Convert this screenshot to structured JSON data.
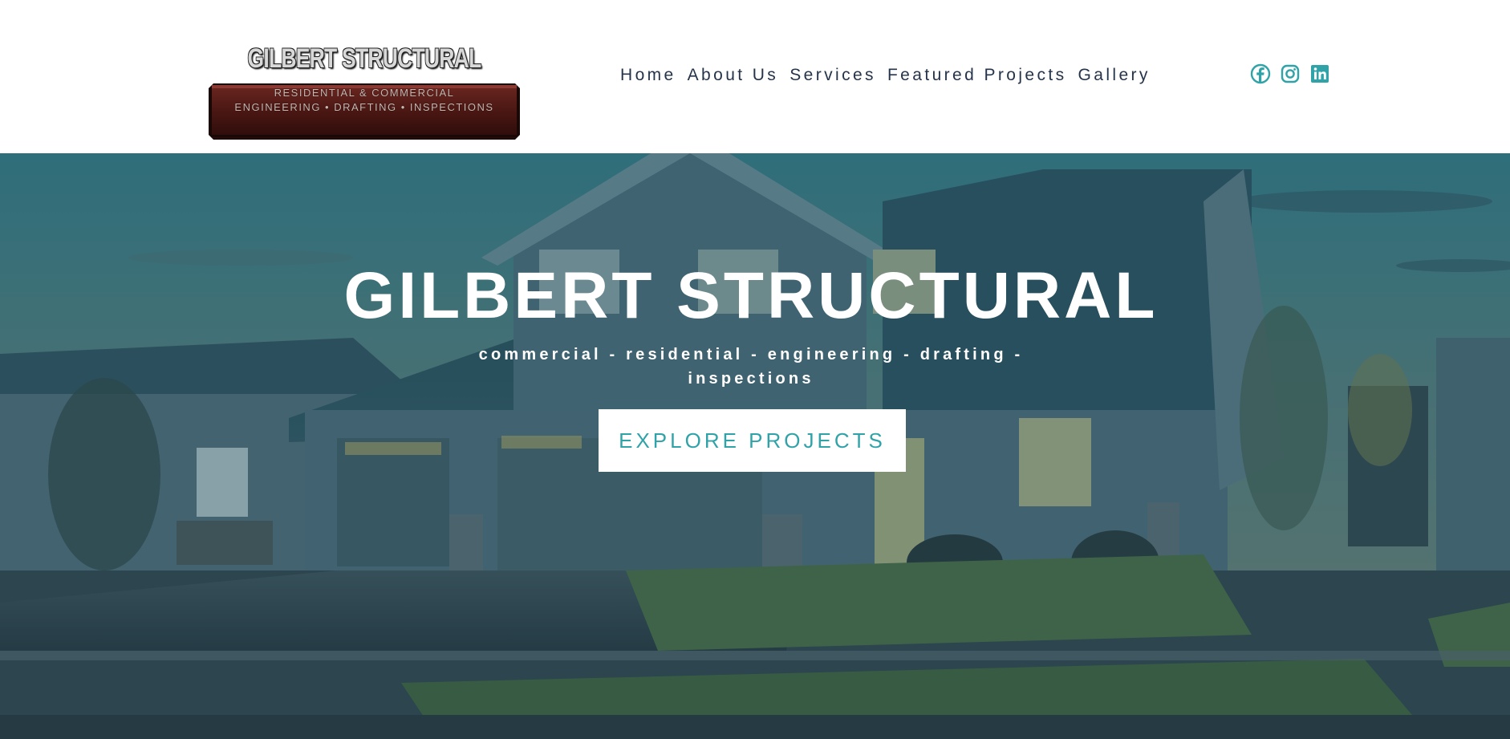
{
  "logo": {
    "title": "GILBERT STRUCTURAL",
    "line1": "RESIDENTIAL & COMMERCIAL",
    "line2": "ENGINEERING • DRAFTING • INSPECTIONS"
  },
  "nav": {
    "items": [
      "Home",
      "About Us",
      "Services",
      "Featured Projects",
      "Gallery"
    ]
  },
  "social": {
    "icons": [
      "facebook-icon",
      "instagram-icon",
      "linkedin-icon"
    ],
    "color": "#2fa3a8"
  },
  "hero": {
    "title": "GILBERT STRUCTURAL",
    "subtitle": "commercial - residential - engineering - drafting - inspections",
    "button_label": "EXPLORE PROJECTS"
  },
  "colors": {
    "accent": "#2fa3a8",
    "nav_text": "#25344a",
    "logo_beam": "#5a1f1a"
  }
}
